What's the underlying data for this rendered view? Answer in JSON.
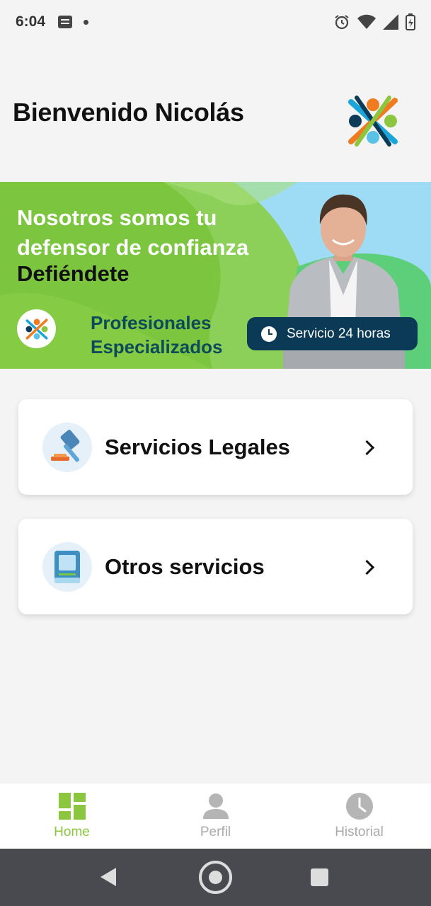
{
  "status_bar": {
    "time": "6:04"
  },
  "header": {
    "title": "Bienvenido Nicolás",
    "logo_icon": "people-cross-logo-icon"
  },
  "banner": {
    "headline": "Nosotros somos tu defensor de confianza",
    "brand": "Defiéndete",
    "pro_line1": "Profesionales",
    "pro_line2": "Especializados",
    "service_pill": "Servicio 24 horas"
  },
  "cards": [
    {
      "label": "Servicios Legales",
      "icon": "gavel-icon"
    },
    {
      "label": "Otros servicios",
      "icon": "book-icon"
    }
  ],
  "bottom_nav": [
    {
      "label": "Home",
      "icon": "grid-icon",
      "active": true
    },
    {
      "label": "Perfil",
      "icon": "person-icon",
      "active": false
    },
    {
      "label": "Historial",
      "icon": "clock-icon",
      "active": false
    }
  ],
  "colors": {
    "accent": "#8cc63f",
    "navy": "#0a3a55",
    "banner_green": "#7cc63f"
  }
}
